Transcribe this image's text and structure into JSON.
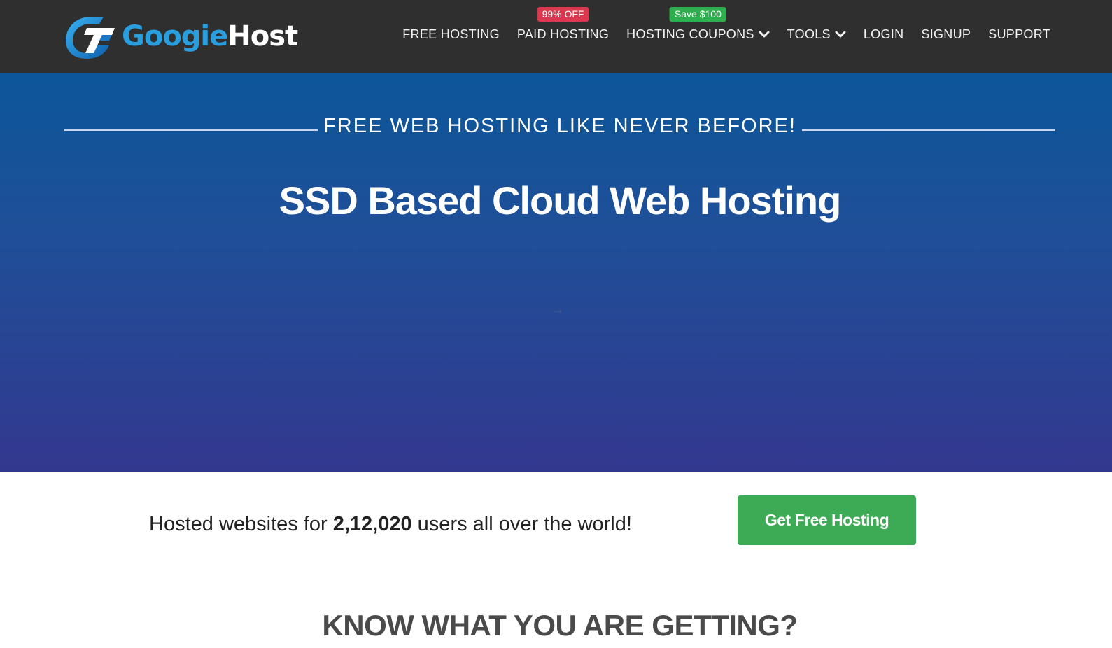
{
  "brand": {
    "name_part1": "Googie",
    "name_part2": "Host",
    "logo_icon": "googiehost-logo-mark",
    "colors": {
      "navbar": "#2f2f2f",
      "brand_blue": "#2a9fe0"
    }
  },
  "nav": {
    "items": [
      {
        "label": "FREE HOSTING",
        "badge": null
      },
      {
        "label": "PAID HOSTING",
        "badge": "99% OFF",
        "badge_color": "#d9384f"
      },
      {
        "label": "HOSTING COUPONS",
        "badge": "Save $100",
        "badge_color": "#2fae4f",
        "dropdown_icon": "chevron-down-icon"
      },
      {
        "label": "TOOLS",
        "dropdown_icon": "chevron-down-icon"
      },
      {
        "label": "LOGIN"
      },
      {
        "label": "SIGNUP"
      },
      {
        "label": "SUPPORT"
      }
    ]
  },
  "hero": {
    "tagline": "FREE WEB HOSTING LIKE NEVER BEFORE!",
    "title": "SSD Based Cloud Web Hosting",
    "arrow": "→",
    "colors": {
      "gradient_top": "#0c5699",
      "gradient_bottom": "#33388f"
    }
  },
  "stats": {
    "prefix": "Hosted websites for ",
    "count": "2,12,020",
    "suffix": " users all over the world!"
  },
  "cta": {
    "label": "Get Free Hosting",
    "color": "#3daa55"
  },
  "section": {
    "heading": "KNOW WHAT YOU ARE GETTING?"
  }
}
